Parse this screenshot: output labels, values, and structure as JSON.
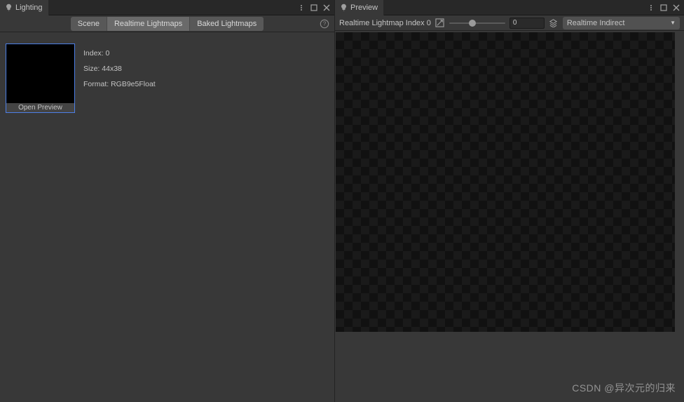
{
  "left": {
    "tab_label": "Lighting",
    "tabs": {
      "scene": "Scene",
      "realtime": "Realtime Lightmaps",
      "baked": "Baked Lightmaps"
    },
    "thumb": {
      "caption": "Open Preview",
      "index": "Index: 0",
      "size": "Size: 44x38",
      "format": "Format: RGB9e5Float"
    }
  },
  "right": {
    "tab_label": "Preview",
    "label": "Realtime Lightmap Index 0",
    "num_value": "0",
    "dropdown": "Realtime Indirect"
  },
  "watermark": "CSDN @异次元的归来"
}
